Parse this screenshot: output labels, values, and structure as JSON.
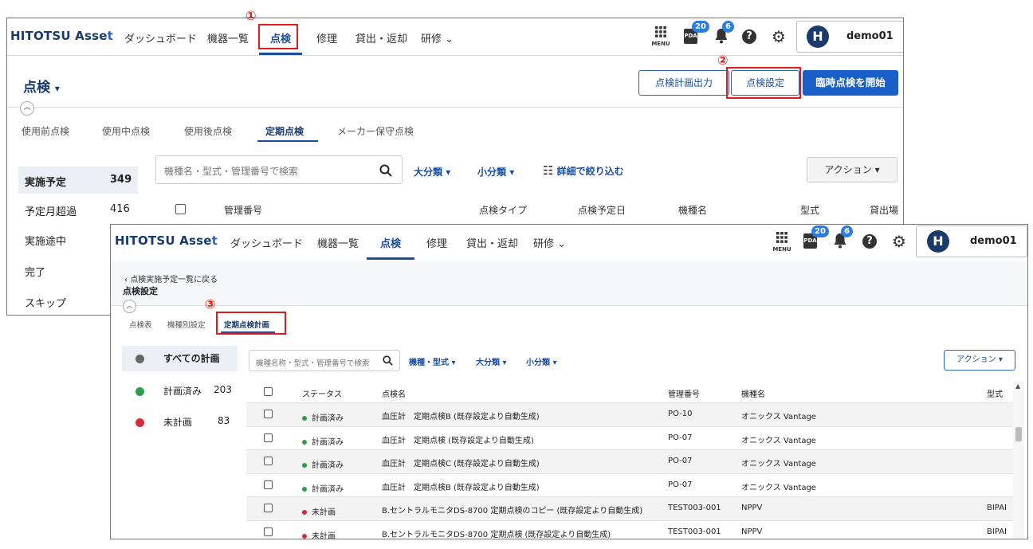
{
  "brand": {
    "name_main": "HITOTSU Asse",
    "name_accent": "t"
  },
  "nav": {
    "dashboard": "ダッシュボード",
    "devices": "機器一覧",
    "inspection": "点検",
    "repair": "修理",
    "lending": "貸出・返却",
    "training": "研修"
  },
  "header": {
    "menu_label": "MENU",
    "pda_label": "PDA",
    "pda_badge": "20",
    "notif_badge": "6",
    "avatar_letter": "H",
    "username": "demo01"
  },
  "annotations": {
    "n1": "①",
    "n2": "②",
    "n3": "③"
  },
  "screen1": {
    "page_title": "点検",
    "btn_plan_output": "点検計画出力",
    "btn_settings": "点検設定",
    "btn_start": "臨時点検を開始",
    "tabs": [
      "使用前点検",
      "使用中点検",
      "使用後点検",
      "定期点検",
      "メーカー保守点検"
    ],
    "search_placeholder": "機種名・型式・管理番号で検索",
    "filter_major": "大分類",
    "filter_minor": "小分類",
    "filter_detail": "詳細で絞り込む",
    "action": "アクション",
    "sidebar": [
      {
        "label": "実施予定",
        "count": "349"
      },
      {
        "label": "予定月超過",
        "count": "416"
      },
      {
        "label": "実施途中",
        "count": ""
      },
      {
        "label": "完了",
        "count": ""
      },
      {
        "label": "スキップ",
        "count": ""
      }
    ],
    "columns": [
      "管理番号",
      "点検タイプ",
      "点検予定日",
      "機種名",
      "型式",
      "貸出場"
    ]
  },
  "screen2": {
    "back_link": "点検実施予定一覧に戻る",
    "page_title": "点検設定",
    "tabs": [
      "点検表",
      "機種別設定",
      "定期点検計画"
    ],
    "sidebar": [
      {
        "label": "すべての計画",
        "count": "",
        "color": "#666666"
      },
      {
        "label": "計画済み",
        "count": "203",
        "color": "#2e9e48"
      },
      {
        "label": "未計画",
        "count": "83",
        "color": "#d42a3a"
      }
    ],
    "search_placeholder": "機種名称・型式・管理番号で検索",
    "filter_model": "機種・型式",
    "filter_major": "大分類",
    "filter_minor": "小分類",
    "action": "アクション",
    "columns": [
      "ステータス",
      "点検名",
      "管理番号",
      "機種名",
      "型式"
    ],
    "rows": [
      {
        "status": "計画済み",
        "status_color": "#2e9e48",
        "name": "血圧計　定期点検B (既存設定より自動生成)",
        "code": "PO-10",
        "model": "オニックス Vantage",
        "type": ""
      },
      {
        "status": "計画済み",
        "status_color": "#2e9e48",
        "name": "血圧計　定期点検 (既存設定より自動生成)",
        "code": "PO-07",
        "model": "オニックス Vantage",
        "type": ""
      },
      {
        "status": "計画済み",
        "status_color": "#2e9e48",
        "name": "血圧計　定期点検C (既存設定より自動生成)",
        "code": "PO-07",
        "model": "オニックス Vantage",
        "type": ""
      },
      {
        "status": "計画済み",
        "status_color": "#2e9e48",
        "name": "血圧計　定期点検B (既存設定より自動生成)",
        "code": "PO-07",
        "model": "オニックス Vantage",
        "type": ""
      },
      {
        "status": "未計画",
        "status_color": "#d42a3a",
        "name": "B.セントラルモニタDS-8700 定期点検のコピー (既存設定より自動生成)",
        "code": "TEST003-001",
        "model": "NPPV",
        "type": "BIPAI"
      },
      {
        "status": "未計画",
        "status_color": "#d42a3a",
        "name": "B.セントラルモニタDS-8700 定期点検 (既存設定より自動生成)",
        "code": "TEST003-001",
        "model": "NPPV",
        "type": "BIPAI"
      }
    ]
  }
}
